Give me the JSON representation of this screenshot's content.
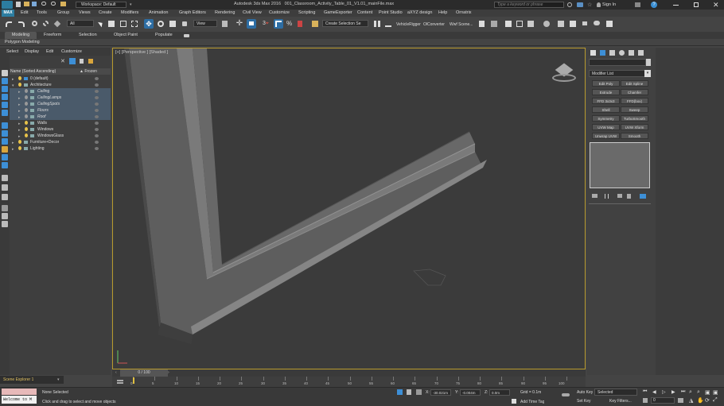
{
  "titlebar": {
    "workspace": "Workspace: Default",
    "app_title": "Autodesk 3ds Max 2016",
    "file_name": "001_Classroom_Activity_Table_01_V1.01_mainFile.max",
    "search_placeholder": "Type a keyword or phrase",
    "sign_in": "Sign In"
  },
  "menu": {
    "items": [
      "MAX",
      "Edit",
      "Tools",
      "Group",
      "Views",
      "Create",
      "Modifiers",
      "Animation",
      "Graph Editors",
      "Rendering",
      "Civil View",
      "Customize",
      "Scripting",
      "GameExporter",
      "Content",
      "Point Studio",
      "aXYZ design",
      "Help",
      "Ornatrix"
    ]
  },
  "toolbar": {
    "selection_filter": "All",
    "view_dropdown": "View",
    "named_selection": "Create Selection Se",
    "extras": [
      "VehicleRigger",
      "OlConverter",
      "Wwf Scene..."
    ]
  },
  "ribbon": {
    "tabs": [
      "Modeling",
      "Freeform",
      "Selection",
      "Object Paint",
      "Populate"
    ],
    "subtitle": "Polygon Modeling"
  },
  "explorer": {
    "menu": [
      "Select",
      "Display",
      "Edit",
      "Customize"
    ],
    "col_name": "Name (Sorted Ascending)",
    "col_frozen": "▲ Frozen",
    "rows": [
      {
        "label": "0 (default)",
        "level": 0,
        "italic": false
      },
      {
        "label": "Architecture",
        "level": 0,
        "italic": false
      },
      {
        "label": "Ceiling",
        "level": 1,
        "italic": true
      },
      {
        "label": "CeilingLamps",
        "level": 1,
        "italic": true
      },
      {
        "label": "CeilingSpots",
        "level": 1,
        "italic": true
      },
      {
        "label": "Floors",
        "level": 1,
        "italic": true
      },
      {
        "label": "Roof",
        "level": 1,
        "italic": true
      },
      {
        "label": "Walls",
        "level": 1,
        "italic": false
      },
      {
        "label": "Windows",
        "level": 1,
        "italic": false
      },
      {
        "label": "WindowsGlass",
        "level": 1,
        "italic": false
      },
      {
        "label": "Furniture+Decor",
        "level": 0,
        "italic": false
      },
      {
        "label": "Lighting",
        "level": 0,
        "italic": false
      }
    ],
    "footer": "Scene Explorer 1"
  },
  "viewport": {
    "label": "[+] [Perspective ] [Shaded ]"
  },
  "cmdpanel": {
    "modifier_list": "Modifier List",
    "buttons": [
      [
        "Edit Poly",
        "Edit Spline"
      ],
      [
        "Extrude",
        "Chamfer"
      ],
      [
        "FFD 3x3x3",
        "FFD(box)"
      ],
      [
        "Shell",
        "Sweep"
      ],
      [
        "Symmetry",
        "TurboSmooth"
      ],
      [
        "UVW Map",
        "UVW Xform"
      ],
      [
        "Unwrap UVW",
        "Smooth"
      ]
    ]
  },
  "timeline": {
    "frame_label": "0 / 100",
    "ticks": [
      "0",
      "5",
      "10",
      "15",
      "20",
      "25",
      "30",
      "35",
      "40",
      "45",
      "50",
      "55",
      "60",
      "65",
      "70",
      "75",
      "80",
      "85",
      "90",
      "95",
      "100"
    ]
  },
  "status": {
    "listener": "Welcome to M",
    "selection": "None Selected",
    "prompt": "Click and drag to select and move objects",
    "x_label": "X:",
    "x_value": "-30.021m",
    "y_label": "Y:",
    "y_value": "-0.004m",
    "z_label": "Z:",
    "z_value": "0.0m",
    "grid": "Grid = 0.1m",
    "add_time_tag": "Add Time Tag",
    "auto_key": "Auto Key",
    "set_key": "Set Key",
    "selected": "Selected",
    "key_filters": "Key Filters...",
    "frame": "0"
  }
}
